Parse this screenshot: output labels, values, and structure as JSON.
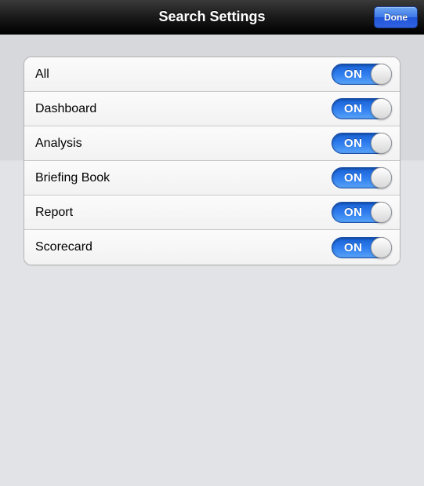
{
  "header": {
    "title": "Search Settings",
    "done_label": "Done"
  },
  "toggle_text": "ON",
  "rows": [
    {
      "label": "All",
      "state": "ON"
    },
    {
      "label": "Dashboard",
      "state": "ON"
    },
    {
      "label": "Analysis",
      "state": "ON"
    },
    {
      "label": "Briefing Book",
      "state": "ON"
    },
    {
      "label": "Report",
      "state": "ON"
    },
    {
      "label": "Scorecard",
      "state": "ON"
    }
  ]
}
